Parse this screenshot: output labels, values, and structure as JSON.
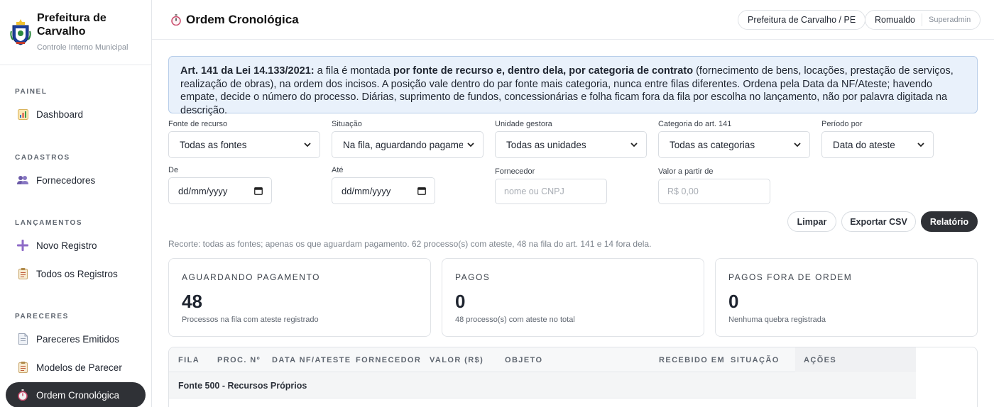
{
  "brand": {
    "title": "Prefeitura de Carvalho",
    "subtitle": "Controle Interno Municipal"
  },
  "sidebar": {
    "sections": [
      {
        "label": "PAINEL",
        "items": [
          {
            "label": "Dashboard",
            "icon": "bar-chart-icon"
          }
        ]
      },
      {
        "label": "CADASTROS",
        "items": [
          {
            "label": "Fornecedores",
            "icon": "users-icon"
          }
        ]
      },
      {
        "label": "LANÇAMENTOS",
        "items": [
          {
            "label": "Novo Registro",
            "icon": "plus-icon"
          },
          {
            "label": "Todos os Registros",
            "icon": "clipboard-icon"
          }
        ]
      },
      {
        "label": "PARECERES",
        "items": [
          {
            "label": "Pareceres Emitidos",
            "icon": "document-icon"
          },
          {
            "label": "Modelos de Parecer",
            "icon": "clipboard-icon"
          },
          {
            "label": "Ordem Cronológica",
            "icon": "stopwatch-icon",
            "active": true
          }
        ]
      }
    ]
  },
  "header": {
    "title": "Ordem Cronológica",
    "title_icon": "stopwatch-icon",
    "org": "Prefeitura de Carvalho / PE",
    "user": "Romualdo",
    "role": "Superadmin"
  },
  "info": {
    "p1": "Art. 141 da Lei 14.133/2021:",
    "p2": " a fila é montada ",
    "p3": "por fonte de recurso e, dentro dela, por categoria de contrato",
    "p4": " (fornecimento de bens, locações, prestação de serviços, realização de obras), na ordem dos incisos. A posição vale dentro do par fonte mais categoria, nunca entre filas diferentes. Ordena pela Data da NF/Ateste; havendo empate, decide o número do processo. Diárias, suprimento de fundos, concessionárias e folha ficam fora da fila por escolha no lançamento, não por palavra digitada na descrição."
  },
  "filters": {
    "fonte": {
      "label": "Fonte de recurso",
      "value": "Todas as fontes"
    },
    "situacao": {
      "label": "Situação",
      "value": "Na fila, aguardando pagamento"
    },
    "unidade": {
      "label": "Unidade gestora",
      "value": "Todas as unidades"
    },
    "categoria": {
      "label": "Categoria do art. 141",
      "value": "Todas as categorias"
    },
    "periodo": {
      "label": "Período por",
      "value": "Data do ateste"
    },
    "de": {
      "label": "De",
      "value": "dd/mm/yyyy"
    },
    "ate": {
      "label": "Até",
      "value": "dd/mm/yyyy"
    },
    "fornecedor": {
      "label": "Fornecedor",
      "placeholder": "nome ou CNPJ"
    },
    "valor": {
      "label": "Valor a partir de",
      "placeholder": "R$ 0,00"
    }
  },
  "buttons": {
    "limpar": "Limpar",
    "exportar": "Exportar CSV",
    "relatorio": "Relatório"
  },
  "summary": "Recorte: todas as fontes; apenas os que aguardam pagamento. 62 processo(s) com ateste, 48 na fila do art. 141 e 14 fora dela.",
  "cards": [
    {
      "label": "AGUARDANDO PAGAMENTO",
      "value": "48",
      "sub": "Processos na fila com ateste registrado"
    },
    {
      "label": "PAGOS",
      "value": "0",
      "sub": "48 processo(s) com ateste no total"
    },
    {
      "label": "PAGOS FORA DE ORDEM",
      "value": "0",
      "sub": "Nenhuma quebra registrada"
    }
  ],
  "table": {
    "columns": [
      "FILA",
      "PROC. Nº",
      "DATA NF/ATESTE",
      "FORNECEDOR",
      "VALOR (R$)",
      "OBJETO",
      "RECEBIDO EM",
      "SITUAÇÃO",
      "AÇÕES"
    ],
    "group": "Fonte 500 - Recursos Próprios"
  },
  "colors": {
    "accent_dark": "#2f3136",
    "info_bg": "#e9f1fb",
    "info_border": "#b7cde9"
  }
}
